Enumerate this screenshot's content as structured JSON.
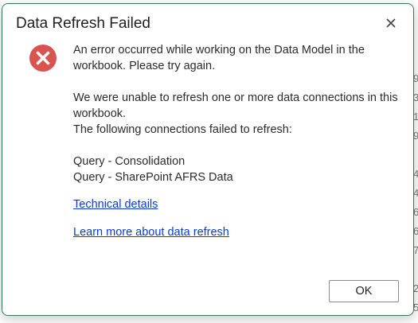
{
  "dialog": {
    "title": "Data Refresh Failed",
    "close_icon": "close-icon",
    "error_icon": "error-circle-x-icon",
    "colors": {
      "error_red": "#d9534f",
      "border_green": "#2e7d4f",
      "link_blue": "#0b3bd4"
    },
    "message_line1": "An error occurred while working on the Data Model in the workbook. Please try again.",
    "message_line2": "We were unable to refresh one or more data connections in this workbook.",
    "message_line3": "The following connections failed to refresh:",
    "connections": [
      "Query - Consolidation",
      "Query - SharePoint AFRS Data"
    ],
    "technical_details_link": "Technical details",
    "learn_more_link": "Learn more about data refresh",
    "ok_label": "OK"
  }
}
